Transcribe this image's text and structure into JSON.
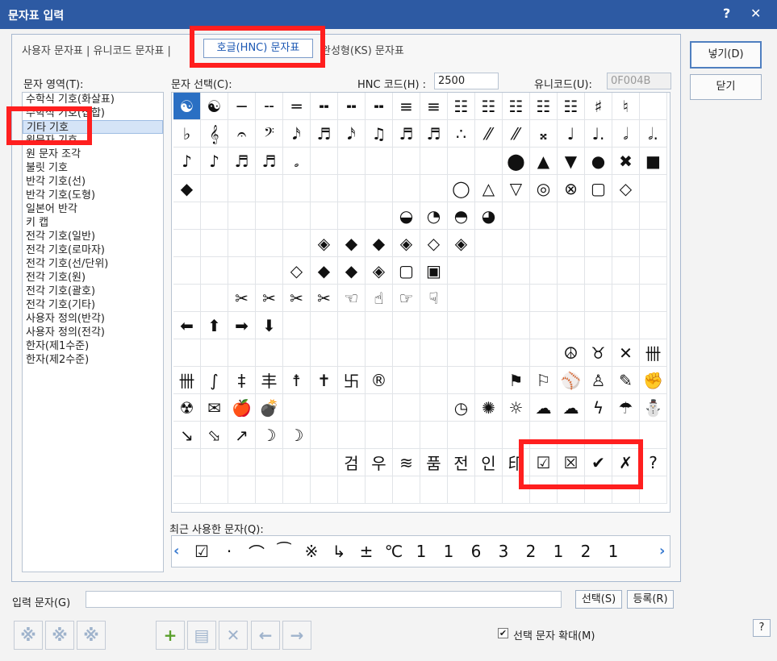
{
  "window": {
    "title": "문자표 입력",
    "help_label": "?",
    "close_label": "✕"
  },
  "tabs": {
    "user": "사용자 문자표 | 유니코드 문자표 | ",
    "active": "호글(HNC) 문자표",
    "ks": "완성형(KS) 문자표"
  },
  "labels": {
    "area": "문자 영역(T):",
    "select": "문자 선택(C):",
    "hnc_code": "HNC 코드(H) :",
    "unicode": "유니코드(U):",
    "recent": "최근 사용한 문자(Q):",
    "input": "입력 문자(G)",
    "enlarge": "선택 문자 확대(M)"
  },
  "fields": {
    "hnc_code": "2500",
    "unicode": "0F004B",
    "input_value": ""
  },
  "areas": [
    "수학식 기호(화살표)",
    "수학식 기호(집합)",
    "기타 기호",
    "원문자 기호",
    "원 문자 조각",
    "불릿 기호",
    "반각 기호(선)",
    "반각 기호(도형)",
    "일본어 반각",
    "키 캡",
    "전각 기호(일반)",
    "전각 기호(로마자)",
    "전각 기호(선/단위)",
    "전각 기호(원)",
    "전각 기호(괄호)",
    "전각 기호(기타)",
    "사용자 정의(반각)",
    "사용자 정의(전각)",
    "한자(제1수준)",
    "한자(제2수준)"
  ],
  "grid": [
    [
      "☯",
      "☯",
      "─",
      "╌",
      "═",
      "╍",
      "╍",
      "╍",
      "≡",
      "≡",
      "☷",
      "☷",
      "☷",
      "☷",
      "☷",
      "♯",
      "♮",
      ""
    ],
    [
      "♭",
      "𝄞",
      "𝄐",
      "𝄢",
      "𝅘𝅥𝅯",
      "♬",
      "𝅘𝅥𝅯",
      "♫",
      "♬",
      "♬",
      "∴",
      "⁄⁄",
      "⁄⁄",
      "𝄪",
      "♩",
      "♩.",
      "𝅗𝅥",
      "𝅗𝅥."
    ],
    [
      "♪",
      "♪",
      "♬",
      "♬",
      "𝅗",
      "",
      "",
      "",
      "",
      "",
      "",
      "",
      "⬤",
      "▲",
      "▼",
      "●",
      "✖",
      "■"
    ],
    [
      "◆",
      "",
      "",
      "",
      "",
      "",
      "",
      "",
      "",
      "",
      "◯",
      "△",
      "▽",
      "◎",
      "⊗",
      "▢",
      "◇",
      ""
    ],
    [
      "",
      "",
      "",
      "",
      "",
      "",
      "",
      "",
      "◒",
      "◔",
      "◓",
      "◕",
      "",
      "",
      "",
      "",
      "",
      ""
    ],
    [
      "",
      "",
      "",
      "",
      "",
      "◈",
      "◆",
      "◆",
      "◈",
      "◇",
      "◈",
      "",
      "",
      "",
      "",
      "",
      "",
      ""
    ],
    [
      "",
      "",
      "",
      "",
      "◇",
      "◆",
      "◆",
      "◈",
      "▢",
      "▣",
      "",
      "",
      "",
      "",
      "",
      "",
      "",
      ""
    ],
    [
      "",
      "",
      "✂",
      "✂",
      "✂",
      "✂",
      "☜",
      "☝",
      "☞",
      "☟",
      "",
      "",
      "",
      "",
      "",
      "",
      "",
      ""
    ],
    [
      "⬅",
      "⬆",
      "➡",
      "⬇",
      "",
      "",
      "",
      "",
      "",
      "",
      "",
      "",
      "",
      "",
      "",
      "",
      "",
      ""
    ],
    [
      "",
      "",
      "",
      "",
      "",
      "",
      "",
      "",
      "",
      "",
      "",
      "",
      "",
      "",
      "☮",
      "♉",
      "✕",
      "卌"
    ],
    [
      "卌",
      "∫",
      "‡",
      "丰",
      "☨",
      "✝",
      "卐",
      "®",
      "",
      "",
      "",
      "",
      "⚑",
      "⚐",
      "⚾",
      "♙",
      "✎",
      "✊"
    ],
    [
      "☢",
      "✉",
      "🍎",
      "💣",
      "",
      "",
      "",
      "",
      "",
      "",
      "◷",
      "✺",
      "☼",
      "☁",
      "☁",
      "ϟ",
      "☂",
      "⛄"
    ],
    [
      "↘",
      "⬂",
      "↗",
      "☽",
      "☽",
      "",
      "",
      "",
      "",
      "",
      "",
      "",
      "",
      "",
      "",
      "",
      "",
      ""
    ],
    [
      "",
      "",
      "",
      "",
      "",
      "",
      "검",
      "우",
      "≋",
      "품",
      "전",
      "인",
      "印",
      "☑",
      "☒",
      "✔",
      "✗",
      "?"
    ],
    [
      "",
      "",
      "",
      "",
      "",
      "",
      "",
      "",
      "",
      "",
      "",
      "",
      "",
      "",
      "",
      "",
      "",
      ""
    ]
  ],
  "recent": [
    "☑",
    "·",
    "⌒",
    "⁀",
    "※",
    "↳",
    "±",
    "℃",
    "1",
    "1",
    "6",
    "3",
    "2",
    "1",
    "2",
    "1"
  ],
  "buttons": {
    "insert": "넣기(D)",
    "close": "닫기",
    "select": "선택(S)",
    "register": "등록(R)"
  },
  "toolbar": {
    "add": "+",
    "delete": "✕",
    "left": "←",
    "right": "→"
  },
  "colors": {
    "titlebar": "#2d5aa3",
    "highlight_box": "#ff1f1f",
    "selected_cell": "#2a6fc3"
  }
}
